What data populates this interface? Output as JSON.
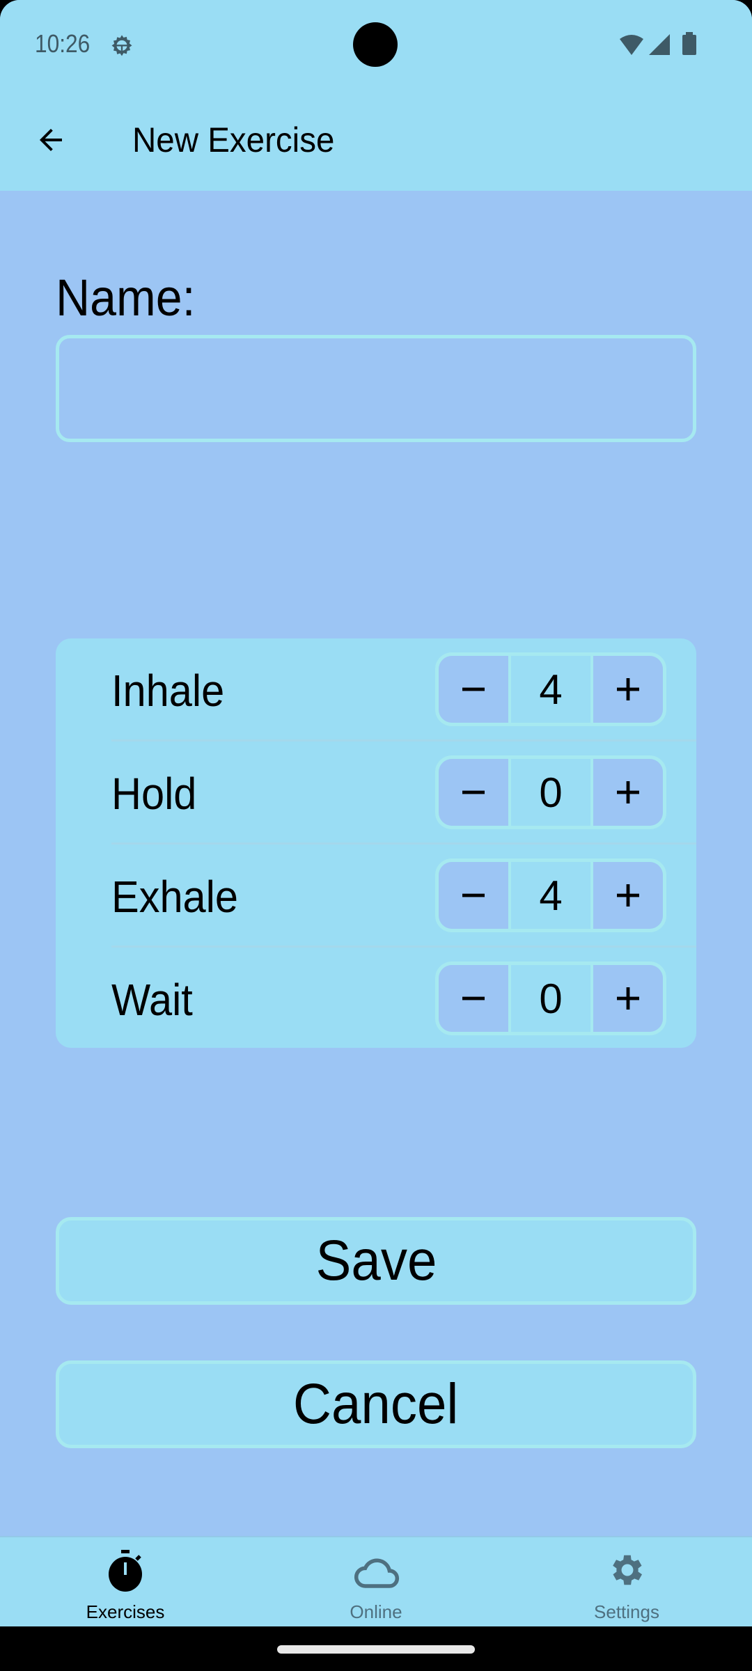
{
  "status_bar": {
    "time": "10:26",
    "icons": [
      "settings-gear-icon",
      "wifi-icon",
      "cellular-signal-icon",
      "battery-icon"
    ]
  },
  "app_bar": {
    "back_icon": "arrow-left-icon",
    "title": "New Exercise"
  },
  "form": {
    "name_label": "Name:",
    "name_value": "",
    "name_placeholder": ""
  },
  "phases": [
    {
      "label": "Inhale",
      "value": "4",
      "decrement": "−",
      "increment": "+"
    },
    {
      "label": "Hold",
      "value": "0",
      "decrement": "−",
      "increment": "+"
    },
    {
      "label": "Exhale",
      "value": "4",
      "decrement": "−",
      "increment": "+"
    },
    {
      "label": "Wait",
      "value": "0",
      "decrement": "−",
      "increment": "+"
    }
  ],
  "actions": {
    "save_label": "Save",
    "cancel_label": "Cancel"
  },
  "bottom_nav": {
    "items": [
      {
        "label": "Exercises",
        "icon": "stopwatch-icon",
        "active": true
      },
      {
        "label": "Online",
        "icon": "cloud-icon",
        "active": false
      },
      {
        "label": "Settings",
        "icon": "gear-icon",
        "active": false
      }
    ]
  },
  "colors": {
    "background": "#9CC5F4",
    "surface": "#9ADDF4",
    "outline": "#A6E9F0",
    "active_nav": "#000000",
    "inactive_nav": "#4E7080"
  }
}
